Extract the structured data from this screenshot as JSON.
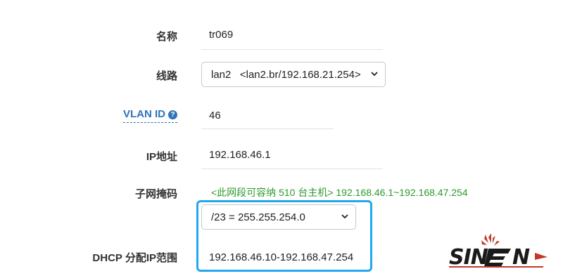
{
  "form": {
    "name": {
      "label": "名称",
      "value": "tr069"
    },
    "line": {
      "label": "线路",
      "selected": "lan2   <lan2.br/192.168.21.254>"
    },
    "vlan": {
      "label": "VLAN ID",
      "value": "46"
    },
    "ip": {
      "label": "IP地址",
      "value": "192.168.46.1"
    },
    "subnet": {
      "label": "子网掩码",
      "hint": "<此网段可容纳 510 台主机> 192.168.46.1~192.168.47.254",
      "selected": "/23 = 255.255.254.0"
    },
    "dhcp": {
      "label": "DHCP 分配IP范围",
      "value": "192.168.46.10-192.168.47.254"
    }
  },
  "watermark": {
    "text": "SIN EN"
  },
  "colors": {
    "accent_blue": "#2f73b8",
    "highlight": "#22a7f0",
    "hint_green": "#2e9a2e"
  }
}
